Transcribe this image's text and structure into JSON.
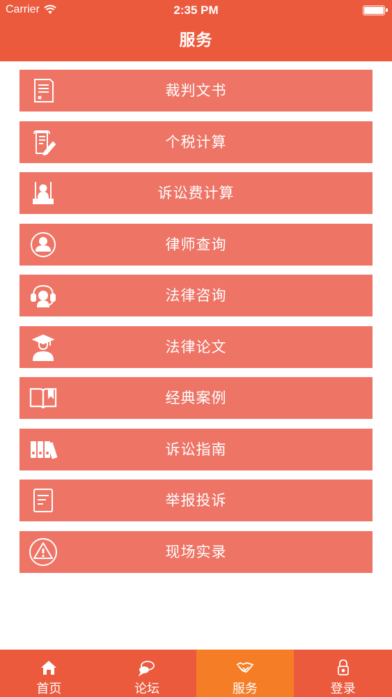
{
  "status_bar": {
    "carrier": "Carrier",
    "time": "2:35 PM"
  },
  "header": {
    "title": "服务"
  },
  "colors": {
    "brand": "#ec5a3d",
    "menu_item": "#ee7466",
    "tab_active": "#f57d26",
    "text": "#ffffff"
  },
  "menu": {
    "items": [
      {
        "label": "裁判文书",
        "icon": "document-icon"
      },
      {
        "label": "个税计算",
        "icon": "tax-document-pen-icon"
      },
      {
        "label": "诉讼费计算",
        "icon": "court-podium-icon"
      },
      {
        "label": "律师查询",
        "icon": "lawyer-person-icon"
      },
      {
        "label": "法律咨询",
        "icon": "headset-support-icon"
      },
      {
        "label": "法律论文",
        "icon": "graduate-cap-icon"
      },
      {
        "label": "经典案例",
        "icon": "open-book-icon"
      },
      {
        "label": "诉讼指南",
        "icon": "binders-icon"
      },
      {
        "label": "举报投诉",
        "icon": "report-form-icon"
      },
      {
        "label": "现场实录",
        "icon": "warning-triangle-icon"
      }
    ]
  },
  "tabbar": {
    "tabs": [
      {
        "label": "首页",
        "icon": "home-icon",
        "active": false
      },
      {
        "label": "论坛",
        "icon": "chat-bubbles-icon",
        "active": false
      },
      {
        "label": "服务",
        "icon": "handshake-icon",
        "active": true
      },
      {
        "label": "登录",
        "icon": "lock-icon",
        "active": false
      }
    ]
  }
}
